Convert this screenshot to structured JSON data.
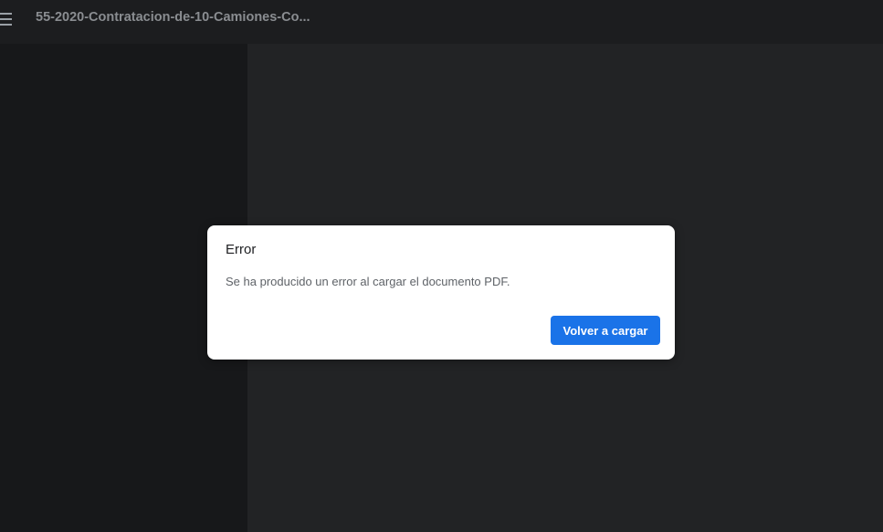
{
  "toolbar": {
    "menu_icon": "hamburger-menu-icon",
    "title": "55-2020-Contratacion-de-10-Camiones-Co..."
  },
  "dialog": {
    "title": "Error",
    "message": "Se ha producido un error al cargar el documento PDF.",
    "reload_label": "Volver a cargar"
  },
  "colors": {
    "toolbar_bg": "#1c1d1f",
    "sidebar_bg": "#17181a",
    "viewer_bg": "#222325",
    "dialog_bg": "#ffffff",
    "primary_button": "#1a73e8"
  }
}
